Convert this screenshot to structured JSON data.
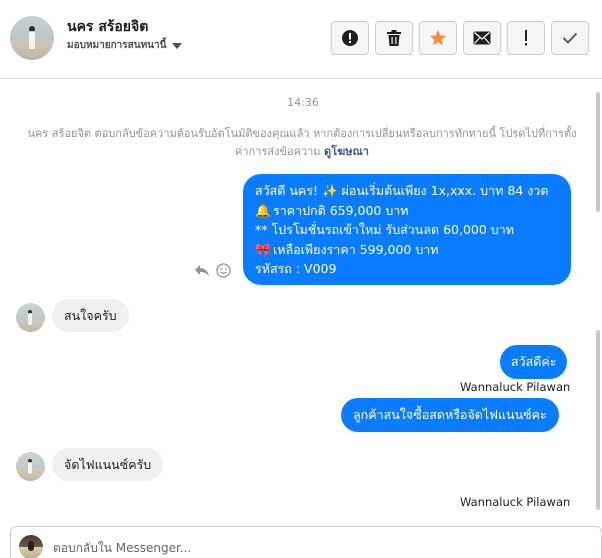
{
  "header": {
    "name": "นคร สร้อยจิต",
    "assign_label": "มอบหมายการสนทนานี้",
    "toolbar": {
      "icons": [
        "alert-circle-icon",
        "trash-icon",
        "star-icon",
        "envelope-icon",
        "exclamation-icon",
        "checkmark-icon"
      ]
    }
  },
  "conversation": {
    "time": "14:36",
    "system_message": "นคร สร้อยจิต ตอบกลับข้อความต้อนรับอัตโนมัติของคุณแล้ว หากต้องการเปลี่ยนหรือลบการทักทายนี้ โปรดไปที่การตั้งค่าการส่งข้อความ",
    "system_link": "ดูโฆษณา",
    "promo": {
      "line1": "สวัสดี นคร! ✨  ผ่อนเริ่มต้นเพียง 1x,xxx. บาท 84 งวด",
      "line2_icon": "🔔",
      "line2": "ราคาปกติ 659,000 บาท",
      "line3": "** โปรโมชั่นรถเข้าใหม่ รับส่วนลด 60,000 บาท",
      "line4_icon": "🎀",
      "line4": " เหลือเพียงราคา 599,000 บาท",
      "line5": " รหัสรถ : V009"
    },
    "msg_in_1": "สนใจครับ",
    "msg_out_1": "สวัสดีค่ะ",
    "sender_1": "Wannaluck Pilawan",
    "msg_out_2": "ลูกค้าสนใจซื้อสดหรือจัดไฟแนนซ์คะ",
    "msg_in_2": "จัดไฟแนนซ์ครับ",
    "sender_2": "Wannaluck Pilawan"
  },
  "composer": {
    "placeholder": "ตอบกลับใน Messenger..."
  },
  "colors": {
    "accent": "#0a7cff",
    "star": "#f5923e",
    "incoming_bubble": "#f0f0f0"
  }
}
